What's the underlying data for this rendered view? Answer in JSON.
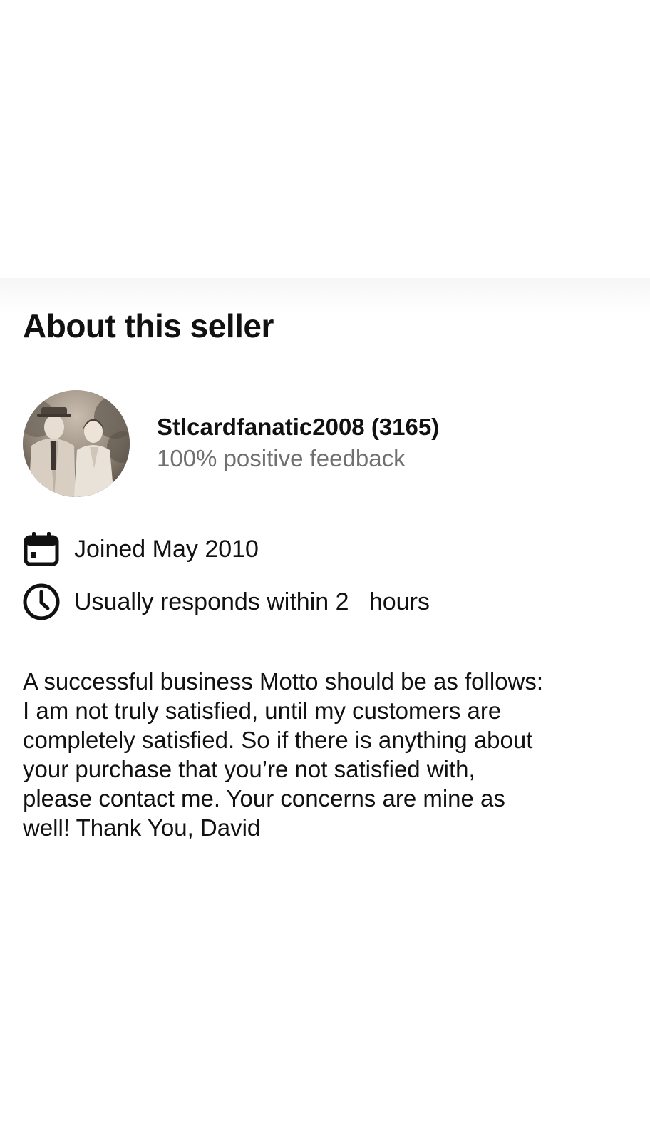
{
  "section": {
    "title": "About this seller"
  },
  "seller": {
    "avatar_icon": "profile-photo",
    "name_with_count": "Stlcardfanatic2008 (3165)",
    "feedback": "100% positive feedback"
  },
  "meta": {
    "joined": {
      "icon": "calendar-icon",
      "text": "Joined May 2010"
    },
    "response": {
      "icon": "clock-icon",
      "text": "Usually responds within 2   hours"
    }
  },
  "description": {
    "lines": [
      "A successful business Motto should be as follows:",
      "I am not truly satisfied, until my customers are",
      "completely satisfied. So if there is anything about",
      "your purchase that you’re not satisfied with,",
      "please contact me. Your concerns are mine as",
      "well! Thank You, David"
    ]
  },
  "colors": {
    "text": "#111111",
    "secondary": "#707070",
    "background": "#ffffff"
  }
}
